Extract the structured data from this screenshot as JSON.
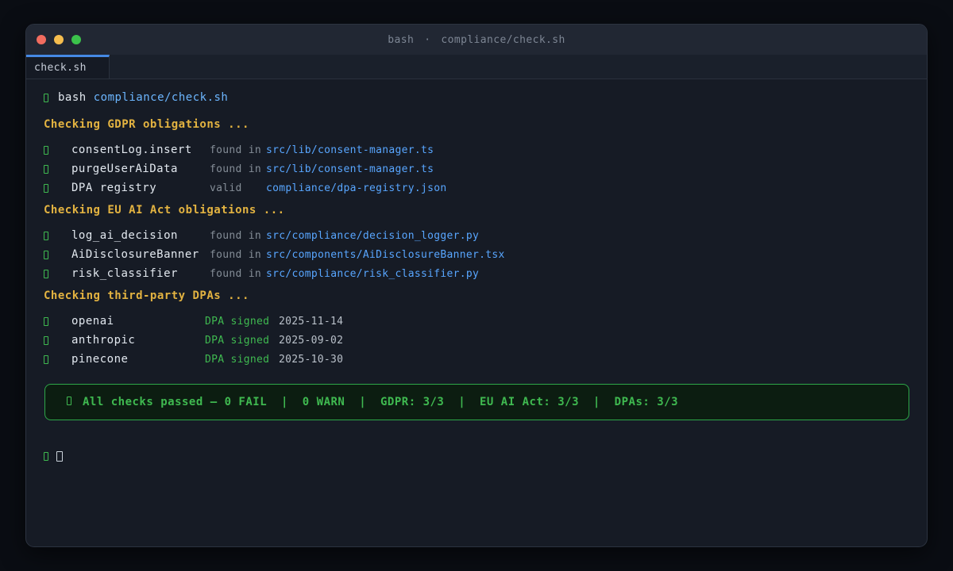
{
  "colors": {
    "accent_blue": "#4589e5",
    "path_blue": "#58a6ff",
    "command_arg_blue": "#6cb6ff",
    "header_yellow": "#e3b341",
    "success_green": "#3fb950",
    "summary_border_green": "#2ea749",
    "summary_bg_green": "#0c1d11",
    "traffic_red": "#f16c5f",
    "traffic_yellow": "#f5bd4e",
    "traffic_green": "#3bc24b"
  },
  "window": {
    "title": {
      "program": "bash",
      "separator": "·",
      "file": "compliance/check.sh"
    },
    "tabs": [
      {
        "label": "check.sh"
      }
    ]
  },
  "terminal": {
    "command": {
      "program": "bash",
      "argument": "compliance/check.sh"
    },
    "sections": [
      {
        "header": "Checking GDPR obligations ...",
        "rows": [
          {
            "name": "consentLog.insert",
            "status": "found in",
            "path": "src/lib/consent-manager.ts"
          },
          {
            "name": "purgeUserAiData",
            "status": "found in",
            "path": "src/lib/consent-manager.ts"
          },
          {
            "name": "DPA registry",
            "status": "valid",
            "path": "compliance/dpa-registry.json"
          }
        ]
      },
      {
        "header": "Checking EU AI Act obligations ...",
        "rows": [
          {
            "name": "log_ai_decision",
            "status": "found in",
            "path": "src/compliance/decision_logger.py"
          },
          {
            "name": "AiDisclosureBanner",
            "status": "found in",
            "path": "src/components/AiDisclosureBanner.tsx"
          },
          {
            "name": "risk_classifier",
            "status": "found in",
            "path": "src/compliance/risk_classifier.py"
          }
        ]
      },
      {
        "header": "Checking third-party DPAs ...",
        "rows": [
          {
            "name": "openai",
            "status": "DPA signed",
            "date": "2025-11-14"
          },
          {
            "name": "anthropic",
            "status": "DPA signed",
            "date": "2025-09-02"
          },
          {
            "name": "pinecone",
            "status": "DPA signed",
            "date": "2025-10-30"
          }
        ]
      }
    ],
    "summary": {
      "text": "All checks passed — 0 FAIL  |  0 WARN  |  GDPR: 3/3  |  EU AI Act: 3/3  |  DPAs: 3/3"
    }
  }
}
